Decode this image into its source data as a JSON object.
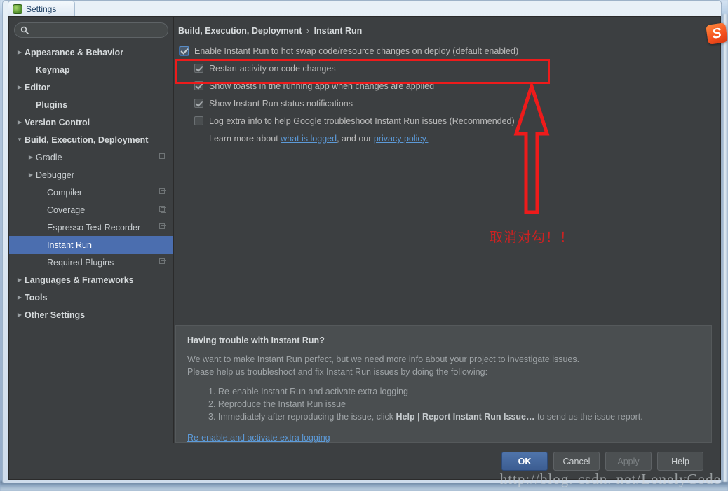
{
  "window": {
    "title": "Settings",
    "close_label": "x",
    "app_icon": "androidstudio-icon"
  },
  "search": {
    "value": "",
    "placeholder": "",
    "icon": "search-icon"
  },
  "sidebar": {
    "items": [
      {
        "label": "Appearance & Behavior",
        "twisty": "▶",
        "bold": true,
        "indent": 0,
        "selected": false,
        "modicon": false
      },
      {
        "label": "Keymap",
        "twisty": "",
        "bold": true,
        "indent": 1,
        "selected": false,
        "modicon": false
      },
      {
        "label": "Editor",
        "twisty": "▶",
        "bold": true,
        "indent": 0,
        "selected": false,
        "modicon": false
      },
      {
        "label": "Plugins",
        "twisty": "",
        "bold": true,
        "indent": 1,
        "selected": false,
        "modicon": false
      },
      {
        "label": "Version Control",
        "twisty": "▶",
        "bold": true,
        "indent": 0,
        "selected": false,
        "modicon": false
      },
      {
        "label": "Build, Execution, Deployment",
        "twisty": "▼",
        "bold": true,
        "indent": 0,
        "selected": false,
        "modicon": false
      },
      {
        "label": "Gradle",
        "twisty": "▶",
        "bold": false,
        "indent": 1,
        "selected": false,
        "modicon": true
      },
      {
        "label": "Debugger",
        "twisty": "▶",
        "bold": false,
        "indent": 1,
        "selected": false,
        "modicon": false
      },
      {
        "label": "Compiler",
        "twisty": "",
        "bold": false,
        "indent": 2,
        "selected": false,
        "modicon": true
      },
      {
        "label": "Coverage",
        "twisty": "",
        "bold": false,
        "indent": 2,
        "selected": false,
        "modicon": true
      },
      {
        "label": "Espresso Test Recorder",
        "twisty": "",
        "bold": false,
        "indent": 2,
        "selected": false,
        "modicon": true
      },
      {
        "label": "Instant Run",
        "twisty": "",
        "bold": false,
        "indent": 2,
        "selected": true,
        "modicon": false
      },
      {
        "label": "Required Plugins",
        "twisty": "",
        "bold": false,
        "indent": 2,
        "selected": false,
        "modicon": true
      },
      {
        "label": "Languages & Frameworks",
        "twisty": "▶",
        "bold": true,
        "indent": 0,
        "selected": false,
        "modicon": false
      },
      {
        "label": "Tools",
        "twisty": "▶",
        "bold": true,
        "indent": 0,
        "selected": false,
        "modicon": false
      },
      {
        "label": "Other Settings",
        "twisty": "▶",
        "bold": true,
        "indent": 0,
        "selected": false,
        "modicon": false
      }
    ]
  },
  "main": {
    "breadcrumb_parent": "Build, Execution, Deployment",
    "breadcrumb_sep": "›",
    "breadcrumb_current": "Instant Run",
    "options": [
      {
        "label": "Enable Instant Run to hot swap code/resource changes on deploy (default enabled)",
        "state": "focused",
        "indent": false
      },
      {
        "label": "Restart activity on code changes",
        "state": "checked",
        "indent": true
      },
      {
        "label": "Show toasts in the running app when changes are applied",
        "state": "checked",
        "indent": true
      },
      {
        "label": "Show Instant Run status notifications",
        "state": "checked",
        "indent": true
      },
      {
        "label": "Log extra info to help Google troubleshoot Instant Run issues (Recommended)",
        "state": "unchecked",
        "indent": true
      }
    ],
    "learn_more": {
      "prefix": "Learn more about ",
      "link1": "what is logged",
      "middle": ", and our ",
      "link2": "privacy policy.",
      "suffix": ""
    }
  },
  "annotation": {
    "note_text": "取消对勾！！",
    "highlight_color": "#ee1b1b",
    "arrow": "up-arrow-outline"
  },
  "trouble": {
    "heading": "Having trouble with Instant Run?",
    "para1": "We want to make Instant Run perfect, but we need more info about your project to investigate issues.",
    "para2": "Please help us troubleshoot and fix Instant Run issues by doing the following:",
    "steps": [
      {
        "num": "1.",
        "text": "Re-enable Instant Run and activate extra logging",
        "bold": "",
        "tail": ""
      },
      {
        "num": "2.",
        "text": "Reproduce the Instant Run issue",
        "bold": "",
        "tail": ""
      },
      {
        "num": "3.",
        "text": "Immediately after reproducing the issue, click ",
        "bold": "Help | Report Instant Run Issue…",
        "tail": " to send us the issue report."
      }
    ],
    "bottom_link": "Re-enable and activate extra logging"
  },
  "footer": {
    "ok": "OK",
    "cancel": "Cancel",
    "apply": "Apply",
    "help": "Help"
  },
  "overlay": {
    "ime_logo": "S",
    "watermark": "http://blog. csdn. net/LonelyCode"
  }
}
